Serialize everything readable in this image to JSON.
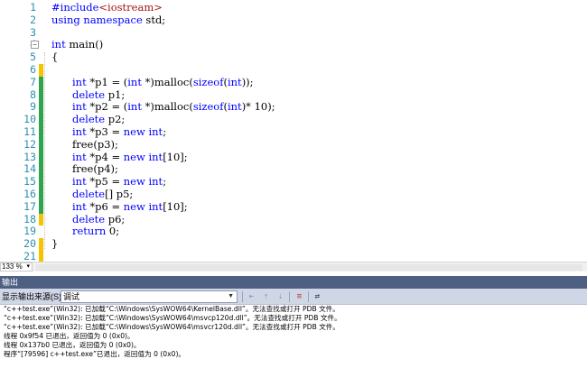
{
  "editor": {
    "lines": [
      {
        "n": "1",
        "text": ""
      },
      {
        "n": "2",
        "text": ""
      },
      {
        "n": "3",
        "text": ""
      },
      {
        "n": "4",
        "text": ""
      },
      {
        "n": "5",
        "text": "{"
      },
      {
        "n": "6",
        "text": ""
      },
      {
        "n": "7",
        "text": ""
      },
      {
        "n": "8",
        "text": ""
      },
      {
        "n": "9",
        "text": ""
      },
      {
        "n": "10",
        "text": ""
      },
      {
        "n": "11",
        "text": ""
      },
      {
        "n": "12",
        "text": ""
      },
      {
        "n": "13",
        "text": ""
      },
      {
        "n": "14",
        "text": ""
      },
      {
        "n": "15",
        "text": ""
      },
      {
        "n": "16",
        "text": ""
      },
      {
        "n": "17",
        "text": ""
      },
      {
        "n": "18",
        "text": ""
      },
      {
        "n": "19",
        "text": ""
      },
      {
        "n": "20",
        "text": "}"
      },
      {
        "n": "21",
        "text": ""
      }
    ],
    "code": {
      "l1_kw": "#include",
      "l1_str": "<iostream>",
      "l2_kw1": "using",
      "l2_kw2": "namespace",
      "l2_rest": " std;",
      "l4_kw": "int",
      "l4_rest": " main()",
      "l7_kw": "int",
      "l7_a": " *p1 = (",
      "l7_kw2": "int",
      "l7_b": " *)malloc(",
      "l7_kw3": "sizeof",
      "l7_c": "(",
      "l7_kw4": "int",
      "l7_d": "));",
      "l8_kw": "delete",
      "l8_rest": " p1;",
      "l9_kw": "int",
      "l9_a": " *p2 = (",
      "l9_kw2": "int",
      "l9_b": " *)malloc(",
      "l9_kw3": "sizeof",
      "l9_c": "(",
      "l9_kw4": "int",
      "l9_d": ")* 10);",
      "l10_kw": "delete",
      "l10_rest": " p2;",
      "l11_kw": "int",
      "l11_a": " *p3 = ",
      "l11_kw2": "new",
      "l11_sp": " ",
      "l11_kw3": "int",
      "l11_b": ";",
      "l12_text": "free(p3);",
      "l13_kw": "int",
      "l13_a": " *p4 = ",
      "l13_kw2": "new",
      "l13_sp": " ",
      "l13_kw3": "int",
      "l13_b": "[10];",
      "l14_text": "free(p4);",
      "l15_kw": "int",
      "l15_a": " *p5 = ",
      "l15_kw2": "new",
      "l15_sp": " ",
      "l15_kw3": "int",
      "l15_b": ";",
      "l16_kw": "delete",
      "l16_rest": "[] p5;",
      "l17_kw": "int",
      "l17_a": " *p6 = ",
      "l17_kw2": "new",
      "l17_sp": " ",
      "l17_kw3": "int",
      "l17_b": "[10];",
      "l18_kw": "delete",
      "l18_rest": " p6;",
      "l19_kw": "return",
      "l19_rest": " 0;"
    }
  },
  "status": {
    "zoom": "133 %"
  },
  "output": {
    "title": "输出",
    "source_label": "显示输出来源(S):",
    "source_value": "调试",
    "lines": [
      "“c++test.exe”(Win32): 已加载“C:\\Windows\\SysWOW64\\KernelBase.dll”。无法查找或打开 PDB 文件。",
      "“c++test.exe”(Win32): 已加载“C:\\Windows\\SysWOW64\\msvcp120d.dll”。无法查找或打开 PDB 文件。",
      "“c++test.exe”(Win32): 已加载“C:\\Windows\\SysWOW64\\msvcr120d.dll”。无法查找或打开 PDB 文件。",
      "线程 0x9f54 已退出，返回值为 0 (0x0)。",
      "线程 0x137b0 已退出，返回值为 0 (0x0)。",
      "程序“[79596] c++test.exe”已退出，返回值为 0 (0x0)。"
    ]
  },
  "colors": {
    "keyword": "#0000ff",
    "string": "#a31515",
    "line_number": "#2b91af",
    "changed_saved": "#2ea44f",
    "changed_unsaved": "#f4c400",
    "output_header": "#4d6082"
  }
}
